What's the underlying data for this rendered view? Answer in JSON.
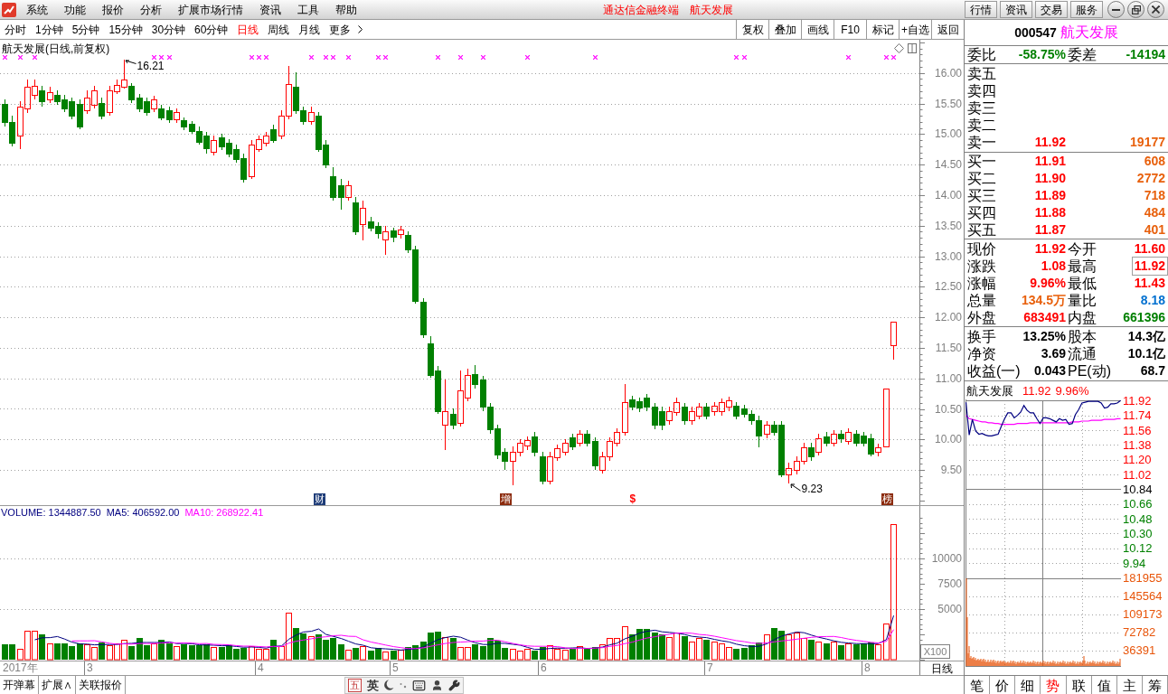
{
  "menu_bar": {
    "items": [
      "系统",
      "功能",
      "报价",
      "分析",
      "扩展市场行情",
      "资讯",
      "工具",
      "帮助"
    ],
    "title": "通达信金融终端",
    "stock_name": "航天发展",
    "buttons": [
      "行情",
      "资讯",
      "交易",
      "服务"
    ]
  },
  "period_tabs": [
    {
      "label": "分时",
      "selected": false
    },
    {
      "label": "1分钟",
      "selected": false
    },
    {
      "label": "5分钟",
      "selected": false
    },
    {
      "label": "15分钟",
      "selected": false
    },
    {
      "label": "30分钟",
      "selected": false
    },
    {
      "label": "60分钟",
      "selected": false
    },
    {
      "label": "日线",
      "selected": true
    },
    {
      "label": "周线",
      "selected": false
    },
    {
      "label": "月线",
      "selected": false
    }
  ],
  "more_button": "更多",
  "toolbar_buttons": [
    "复权",
    "叠加",
    "画线",
    "F10",
    "标记",
    "+自选",
    "返回"
  ],
  "price_chart": {
    "title": "航天发展(日线,前复权)",
    "high_label": "16.21",
    "low_label": "9.23",
    "y_ticks": [
      "16.00",
      "15.50",
      "15.00",
      "14.50",
      "14.00",
      "13.50",
      "13.00",
      "12.50",
      "12.00",
      "11.50",
      "11.00",
      "10.50",
      "10.00",
      "9.50"
    ],
    "event_markers": [
      {
        "text": "财",
        "kind": "badge",
        "color": "#1e3c78"
      },
      {
        "text": "增",
        "kind": "badge",
        "color": "#8b2a0c"
      },
      {
        "text": "$",
        "kind": "glyph",
        "color": "#ff0000"
      },
      {
        "text": "榜",
        "kind": "badge",
        "color": "#8b2a0c"
      }
    ]
  },
  "volume_chart": {
    "volume": "VOLUME: 1344887.50",
    "ma5": "MA5: 406592.00",
    "ma10": "MA10: 268922.41",
    "y_ticks": [
      "10000",
      "7500",
      "5000"
    ],
    "unit": "X100"
  },
  "date_axis": {
    "labels": [
      "2017年",
      "3",
      "4",
      "5",
      "6",
      "7",
      "8"
    ],
    "period": "日线"
  },
  "bottom_bar": {
    "buttons": [
      "开弹幕",
      "扩展∧",
      "关联报价"
    ],
    "ime_mode": "五",
    "ime_language": "英"
  },
  "quote": {
    "code": "000547",
    "name": "航天发展",
    "order_ratio": {
      "label": "委比",
      "value": "-58.75%",
      "diff_label": "委差",
      "diff": "-14194"
    },
    "asks": [
      {
        "label": "卖五"
      },
      {
        "label": "卖四"
      },
      {
        "label": "卖三"
      },
      {
        "label": "卖二"
      },
      {
        "label": "卖一",
        "price": "11.92",
        "volume": "19177"
      }
    ],
    "bids": [
      {
        "label": "买一",
        "price": "11.91",
        "volume": "608"
      },
      {
        "label": "买二",
        "price": "11.90",
        "volume": "2772"
      },
      {
        "label": "买三",
        "price": "11.89",
        "volume": "718"
      },
      {
        "label": "买四",
        "price": "11.88",
        "volume": "484"
      },
      {
        "label": "买五",
        "price": "11.87",
        "volume": "401"
      }
    ],
    "stats": [
      {
        "label": "现价",
        "value": "11.92",
        "color": "#ff0000",
        "boxed": false
      },
      {
        "label": "今开",
        "value": "11.60",
        "color": "#ff0000",
        "boxed": false
      },
      {
        "label": "涨跌",
        "value": "1.08",
        "color": "#ff0000",
        "boxed": false
      },
      {
        "label": "最高",
        "value": "11.92",
        "color": "#ff0000",
        "boxed": true
      },
      {
        "label": "涨幅",
        "value": "9.96%",
        "color": "#ff0000",
        "boxed": false
      },
      {
        "label": "最低",
        "value": "11.43",
        "color": "#ff0000",
        "boxed": false
      },
      {
        "label": "总量",
        "value": "134.5万",
        "color": "#e8600c",
        "boxed": false
      },
      {
        "label": "量比",
        "value": "8.18",
        "color": "#0070d0",
        "boxed": false
      },
      {
        "label": "外盘",
        "value": "683491",
        "color": "#ff0000",
        "boxed": false
      },
      {
        "label": "内盘",
        "value": "661396",
        "color": "#008000",
        "boxed": false
      }
    ],
    "fundamentals": [
      {
        "label": "换手",
        "value": "13.25%"
      },
      {
        "label": "股本",
        "value": "14.3亿"
      },
      {
        "label": "净资",
        "value": "3.69"
      },
      {
        "label": "流通",
        "value": "10.1亿"
      },
      {
        "label": "收益(一)",
        "value": "0.043"
      },
      {
        "label": "PE(动)",
        "value": "68.7"
      }
    ]
  },
  "intraday": {
    "name": "航天发展",
    "price": "11.92",
    "change": "9.96%",
    "chart_data": {
      "type": "line",
      "ylim": [
        9.94,
        11.92
      ],
      "yticks": [
        11.92,
        11.74,
        11.56,
        11.38,
        {
          "value": 11.2,
          "label": "11.20"
        },
        11.02,
        10.66,
        10.48,
        {
          "value": 10.3,
          "label": "10.30"
        },
        10.12,
        9.94
      ],
      "ref_lines": [
        {
          "axis": "y",
          "value": 10.84,
          "label": "10.84"
        }
      ],
      "grid": true,
      "series": [
        {
          "color": "#000080",
          "values": [
            11.9,
            11.5,
            11.69,
            11.55,
            11.51,
            11.52,
            11.5,
            11.49,
            11.49,
            11.5,
            11.51,
            11.61,
            11.7,
            11.77,
            11.77,
            11.71,
            11.74,
            11.78,
            11.86,
            11.8,
            11.77,
            11.77,
            11.7,
            11.64,
            11.71,
            11.71,
            11.7,
            11.68,
            11.66,
            11.7,
            11.68,
            11.69,
            11.63,
            11.64,
            11.75,
            11.81,
            11.89,
            11.9,
            11.91,
            11.91,
            11.91,
            11.91,
            11.89,
            11.83,
            11.84,
            11.88,
            11.88,
            11.89,
            11.92
          ]
        },
        {
          "color": "#ff00ff",
          "values": [
            11.74,
            11.7,
            11.69,
            11.68,
            11.67,
            11.66,
            11.66,
            11.65,
            11.65,
            11.64,
            11.64,
            11.63,
            11.63,
            11.63,
            11.63,
            11.63,
            11.64,
            11.64,
            11.64,
            11.64,
            11.65,
            11.65,
            11.65,
            11.65,
            11.65,
            11.65,
            11.65,
            11.65,
            11.65,
            11.65,
            11.65,
            11.65,
            11.65,
            11.66,
            11.66,
            11.66,
            11.67,
            11.67,
            11.67,
            11.68,
            11.68,
            11.68,
            11.68,
            11.69,
            11.69,
            11.69,
            11.69,
            11.7,
            11.7
          ]
        }
      ]
    },
    "volume_ticks": [
      "181955",
      "145564",
      "109173",
      "72782",
      "36391"
    ]
  },
  "bottom_tabs": [
    {
      "label": "笔",
      "selected": false
    },
    {
      "label": "价",
      "selected": false
    },
    {
      "label": "细",
      "selected": false
    },
    {
      "label": "势",
      "selected": true
    },
    {
      "label": "联",
      "selected": false
    },
    {
      "label": "值",
      "selected": false
    },
    {
      "label": "主",
      "selected": false
    },
    {
      "label": "筹",
      "selected": false
    }
  ]
}
